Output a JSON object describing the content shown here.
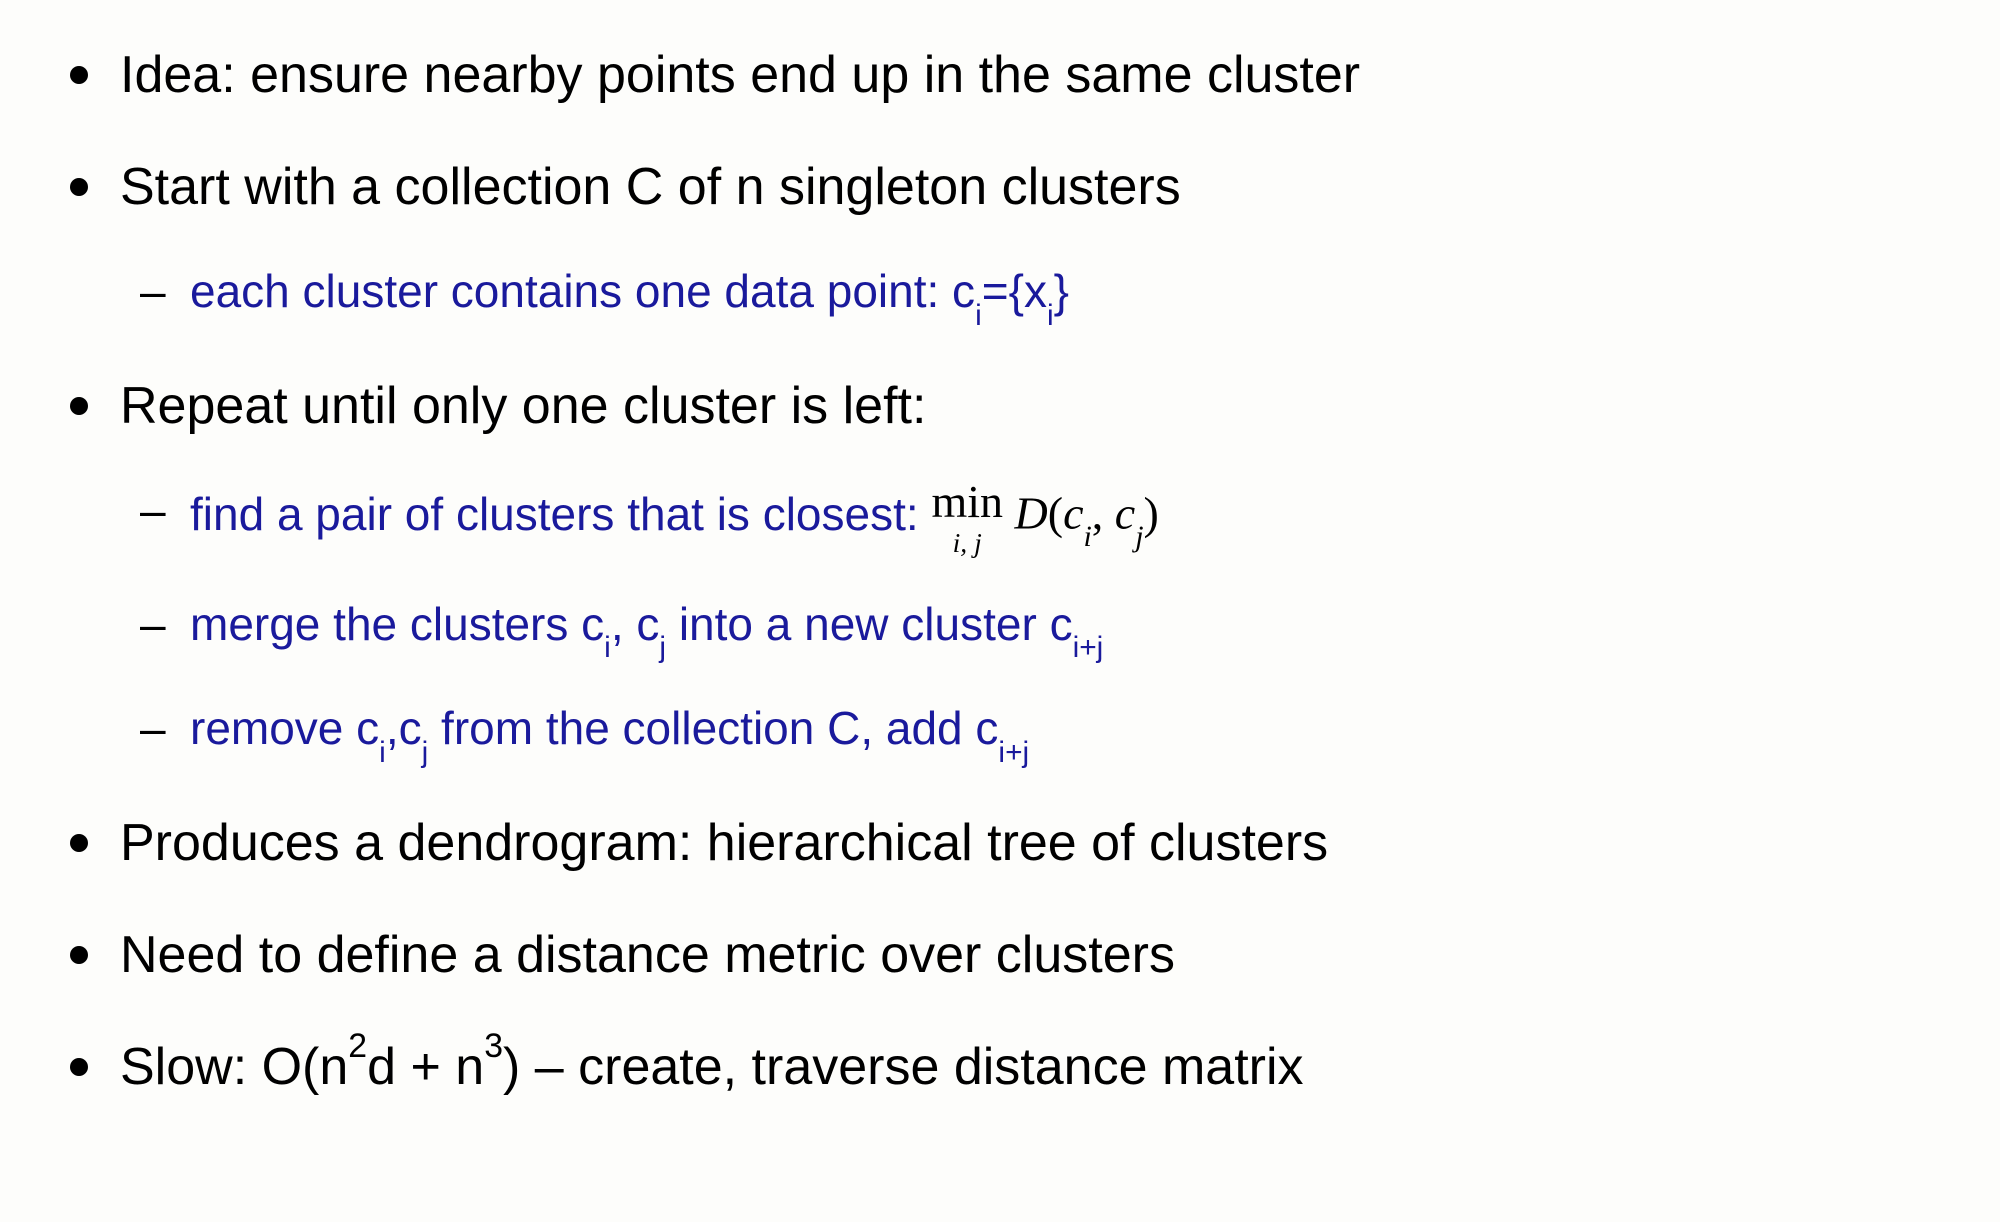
{
  "bullets": {
    "b1": "Idea: ensure nearby points end up in the same cluster",
    "b2": "Start with a collection C of n singleton clusters",
    "b3": "Repeat until only one cluster is left:",
    "b4": "Produces a dendrogram: hierarchical tree of clusters",
    "b5": "Need to define a distance metric over clusters",
    "b6_pre": "Slow: O(n",
    "b6_sup1": "2",
    "b6_mid": "d + n",
    "b6_sup2": "3",
    "b6_post": ") – create, traverse distance matrix"
  },
  "sub2": {
    "s1_pre": "each cluster contains one data point: c",
    "s1_sub1": "i",
    "s1_mid": "={x",
    "s1_sub2": "i",
    "s1_post": "}"
  },
  "sub3": {
    "s1_text": "find a pair of clusters that is closest:   ",
    "s1_min": "min",
    "s1_min_sub": "i, j",
    "s1_D": " D",
    "s1_open": "(",
    "s1_c1": "c",
    "s1_c1sub": "i",
    "s1_comma": ", ",
    "s1_c2": "c",
    "s1_c2sub": "j",
    "s1_close": ")",
    "s2_pre": "merge the clusters c",
    "s2_sub1": "i",
    "s2_mid1": ", c",
    "s2_sub2": "j",
    "s2_mid2": " into a new cluster c",
    "s2_sub3": "i+j",
    "s3_pre": "remove c",
    "s3_sub1": "i",
    "s3_mid1": ",c",
    "s3_sub2": "j",
    "s3_mid2": " from the collection C, add c",
    "s3_sub3": "i+j"
  }
}
